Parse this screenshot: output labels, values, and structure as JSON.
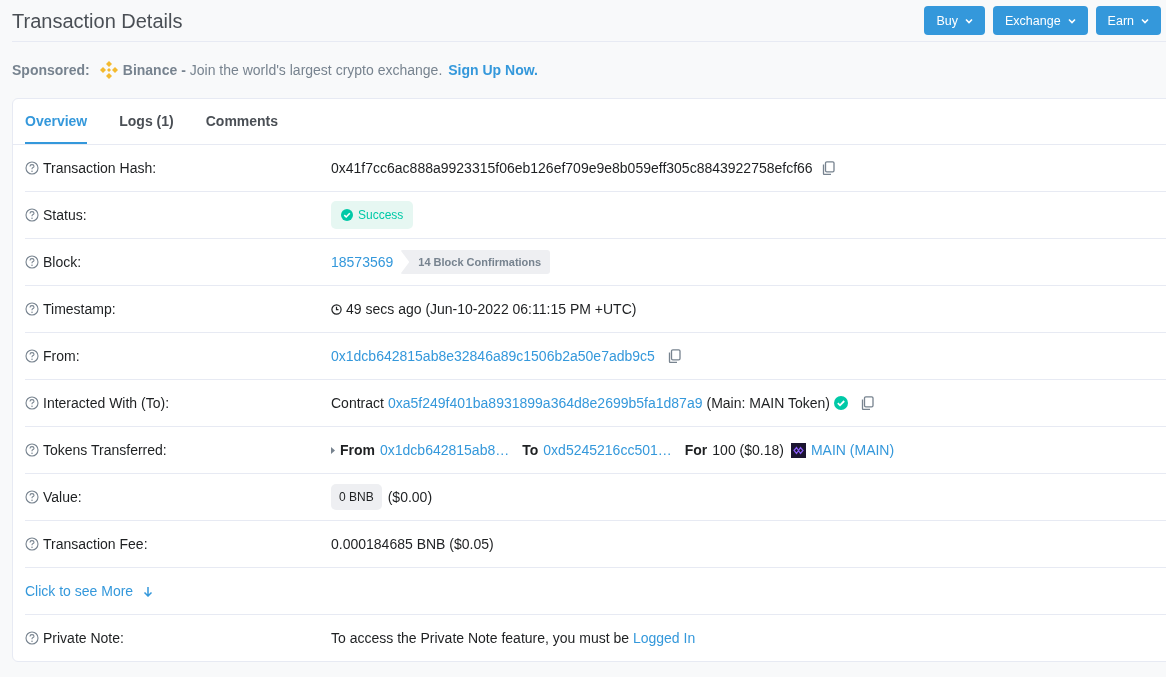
{
  "header": {
    "title": "Transaction Details",
    "buttons": [
      {
        "label": "Buy"
      },
      {
        "label": "Exchange"
      },
      {
        "label": "Earn"
      }
    ]
  },
  "sponsor": {
    "label": "Sponsored:",
    "brand": "Binance -",
    "text": "Join the world's largest crypto exchange.",
    "link": "Sign Up Now."
  },
  "tabs": [
    {
      "label": "Overview",
      "selected": true
    },
    {
      "label": "Logs (1)",
      "selected": false
    },
    {
      "label": "Comments",
      "selected": false
    }
  ],
  "rows": [
    {
      "kind": "hash",
      "label": "Transaction Hash:",
      "value": "0x41f7cc6ac888a9923315f06eb126ef709e9e8b059eff305c8843922758efcf66"
    },
    {
      "kind": "status",
      "label": "Status:",
      "value": "Success"
    },
    {
      "kind": "block",
      "label": "Block:",
      "value": "18573569",
      "badge": "14 Block Confirmations"
    },
    {
      "kind": "timestamp",
      "label": "Timestamp:",
      "value": "49 secs ago (Jun-10-2022 06:11:15 PM +UTC)"
    },
    {
      "kind": "address",
      "label": "From:",
      "value": "0x1dcb642815ab8e32846a89c1506b2a50e7adb9c5"
    },
    {
      "kind": "contract",
      "label": "Interacted With (To):",
      "prefix": "Contract",
      "value": "0xa5f249f401ba8931899a364d8e2699b5fa1d87a9",
      "note": "(Main: MAIN Token)"
    },
    {
      "kind": "transfer",
      "label": "Tokens Transferred:",
      "from_label": "From",
      "from": "0x1dcb642815ab8…",
      "to_label": "To",
      "to": "0xd5245216cc501…",
      "for_label": "For",
      "amount": "100 ($0.18)",
      "token": "MAIN (MAIN)"
    },
    {
      "kind": "value",
      "label": "Value:",
      "badge": "0 BNB",
      "value": "($0.00)"
    },
    {
      "kind": "fee",
      "label": "Transaction Fee:",
      "value": "0.000184685 BNB ($0.05)"
    },
    {
      "kind": "more",
      "link": "Click to see More"
    },
    {
      "kind": "note",
      "label": "Private Note:",
      "text": "To access the Private Note feature, you must be",
      "link": "Logged In"
    }
  ]
}
